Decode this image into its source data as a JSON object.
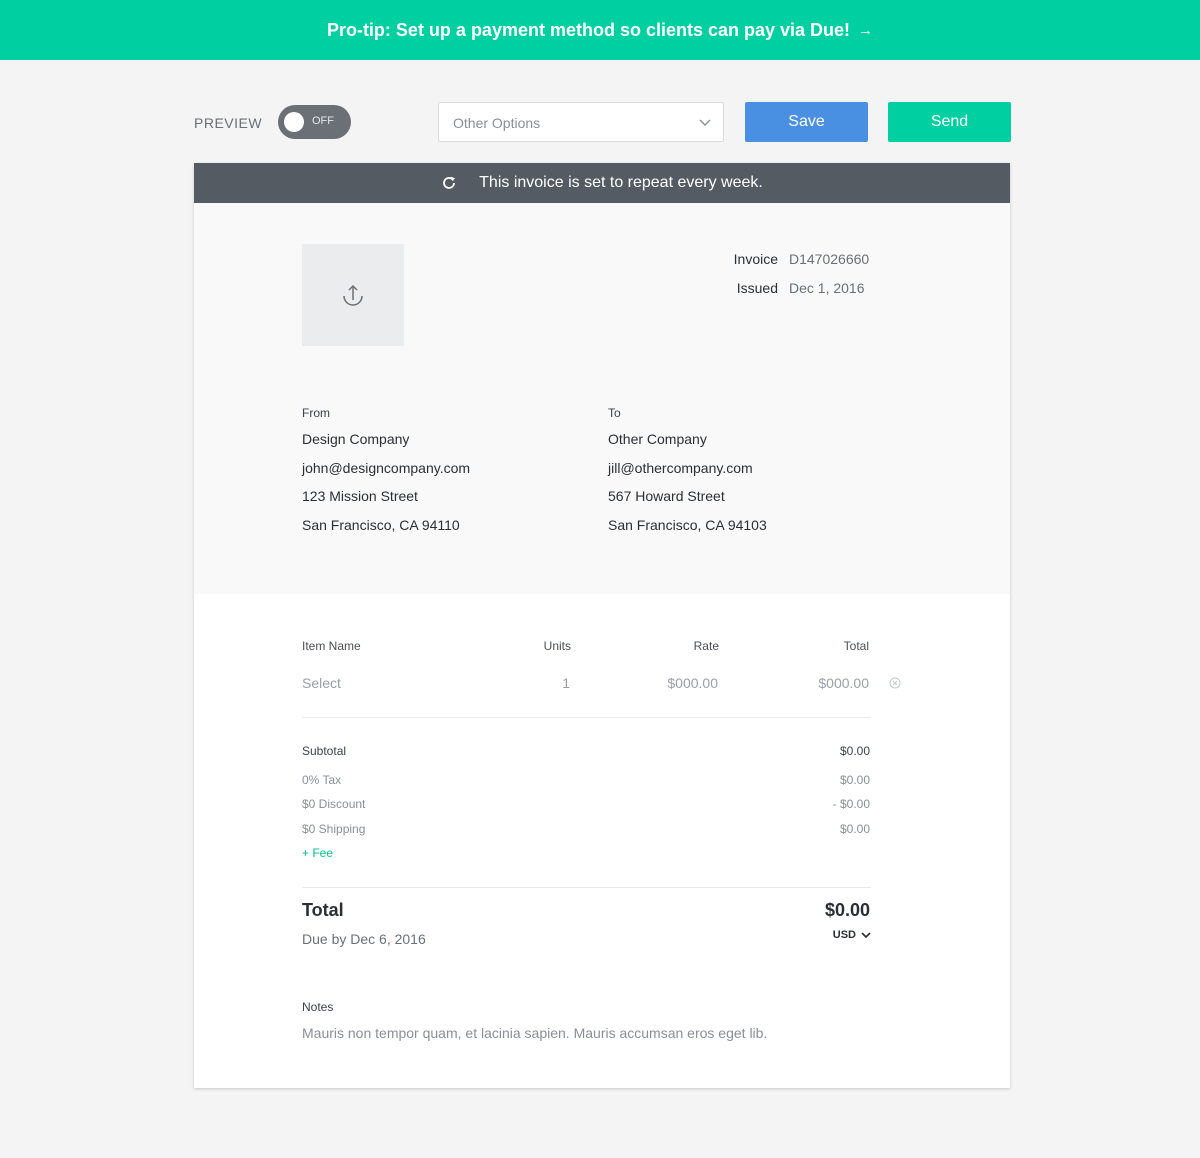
{
  "banner": {
    "text": "Pro-tip: Set up a payment method so clients can pay via Due!",
    "arrow": "→"
  },
  "toolbar": {
    "preview_label": "PREVIEW",
    "toggle_state": "OFF",
    "options_value": "Other Options",
    "save_label": "Save",
    "send_label": "Send"
  },
  "repeat_notice": "This invoice is set to repeat every week.",
  "invoice": {
    "number_label": "Invoice",
    "number": "D147026660",
    "issued_label": "Issued",
    "issued": "Dec 1, 2016"
  },
  "from": {
    "label": "From",
    "name": "Design Company",
    "email": "john@designcompany.com",
    "street": "123 Mission Street",
    "city": "San Francisco, CA 94110"
  },
  "to": {
    "label": "To",
    "name": "Other Company",
    "email": "jill@othercompany.com",
    "street": "567 Howard Street",
    "city": "San Francisco, CA 94103"
  },
  "items": {
    "headers": {
      "name": "Item Name",
      "units": "Units",
      "rate": "Rate",
      "total": "Total"
    },
    "rows": [
      {
        "name": "Select",
        "units": "1",
        "rate": "$000.00",
        "total": "$000.00"
      }
    ]
  },
  "summary": {
    "subtotal_label": "Subtotal",
    "subtotal": "$0.00",
    "tax_label": "0% Tax",
    "tax": "$0.00",
    "discount_label": "$0 Discount",
    "discount": "- $0.00",
    "shipping_label": "$0 Shipping",
    "shipping": "$0.00",
    "fee_link": "+ Fee"
  },
  "total": {
    "label": "Total",
    "value": "$0.00",
    "due": "Due by Dec 6, 2016",
    "currency": "USD"
  },
  "notes": {
    "label": "Notes",
    "text": "Mauris non tempor quam, et lacinia sapien. Mauris accumsan eros eget lib."
  },
  "colors": {
    "accent_green": "#00cfa1",
    "save_blue": "#4a90e2",
    "repeat_bar": "#555b62"
  }
}
